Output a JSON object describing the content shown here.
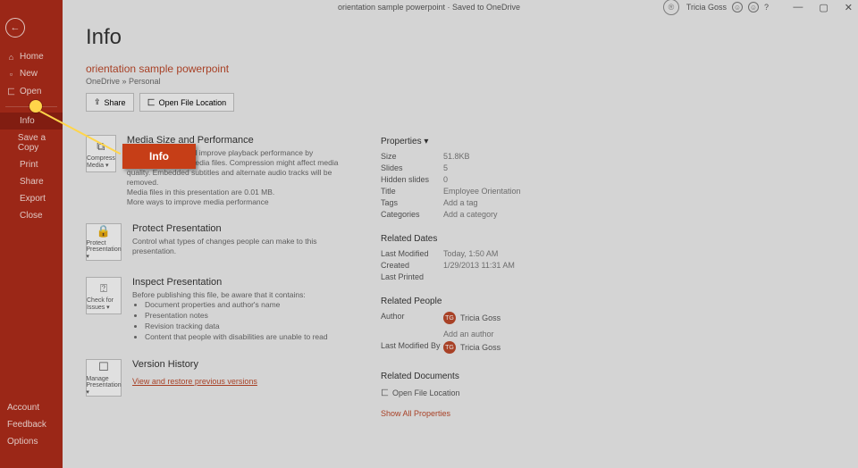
{
  "titlebar": {
    "title": "orientation sample powerpoint · Saved to OneDrive",
    "user": "Tricia Goss",
    "win_min": "—",
    "win_max": "▢",
    "win_close": "✕",
    "ribbon_toggle": "^"
  },
  "sidebar": {
    "back": "←",
    "home": "Home",
    "new": "New",
    "open": "Open",
    "info": "Info",
    "save_copy": "Save a Copy",
    "print": "Print",
    "share": "Share",
    "export": "Export",
    "close": "Close",
    "account": "Account",
    "feedback": "Feedback",
    "options": "Options"
  },
  "page": {
    "title": "Info",
    "file_name": "orientation sample powerpoint",
    "file_loc": "OneDrive » Personal",
    "share_btn": "Share",
    "open_loc_btn": "Open File Location"
  },
  "sections": {
    "media": {
      "btn": "Compress Media ▾",
      "title": "Media Size and Performance",
      "desc1": "Save disk space and improve playback performance by compressing your media files. Compression might affect media quality. Embedded subtitles and alternate audio tracks will be removed.",
      "desc2": "Media files in this presentation are 0.01 MB.",
      "desc3": "More ways to improve media performance"
    },
    "protect": {
      "btn": "Protect Presentation ▾",
      "title": "Protect Presentation",
      "desc": "Control what types of changes people can make to this presentation."
    },
    "inspect": {
      "btn": "Check for Issues ▾",
      "title": "Inspect Presentation",
      "desc": "Before publishing this file, be aware that it contains:",
      "b1": "Document properties and author's name",
      "b2": "Presentation notes",
      "b3": "Revision tracking data",
      "b4": "Content that people with disabilities are unable to read"
    },
    "history": {
      "btn": "Manage Presentation ▾",
      "title": "Version History",
      "link": "View and restore previous versions"
    }
  },
  "props": {
    "head": "Properties ▾",
    "size_k": "Size",
    "size_v": "51.8KB",
    "slides_k": "Slides",
    "slides_v": "5",
    "hidden_k": "Hidden slides",
    "hidden_v": "0",
    "title_k": "Title",
    "title_v": "Employee Orientation",
    "tags_k": "Tags",
    "tags_v": "Add a tag",
    "cat_k": "Categories",
    "cat_v": "Add a category",
    "dates_head": "Related Dates",
    "mod_k": "Last Modified",
    "mod_v": "Today, 1:50 AM",
    "created_k": "Created",
    "created_v": "1/29/2013 11:31 AM",
    "printed_k": "Last Printed",
    "printed_v": "",
    "people_head": "Related People",
    "author_k": "Author",
    "author_v": "Tricia Goss",
    "add_author": "Add an author",
    "modby_k": "Last Modified By",
    "modby_v": "Tricia Goss",
    "docs_head": "Related Documents",
    "open_loc": "Open File Location",
    "show_all": "Show All Properties",
    "initials": "TG"
  },
  "callout": {
    "label": "Info"
  }
}
